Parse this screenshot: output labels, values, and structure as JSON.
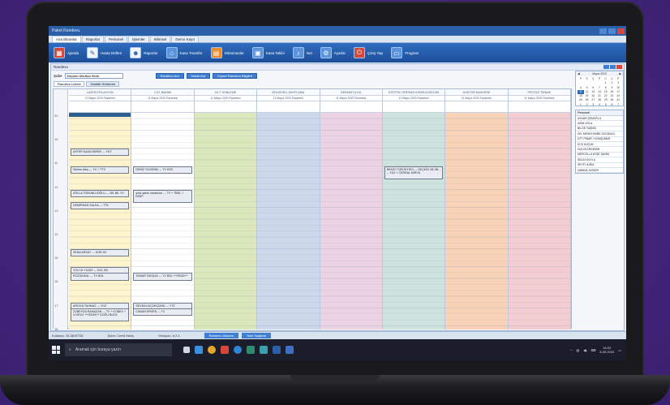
{
  "app": {
    "title": "Paket Randevu"
  },
  "menu_tabs": [
    "Ana Ekranlar",
    "Raporlar",
    "Personel",
    "İşlemler",
    "Bilimsel",
    "Demo Kayıt"
  ],
  "ribbon": [
    {
      "label": "Ajanda",
      "icon": "calendar-icon",
      "style": "red"
    },
    {
      "label": "Hasta Defteri",
      "icon": "pencil-icon",
      "style": "white"
    },
    {
      "label": "Raporlar",
      "icon": "user-icon",
      "style": "white"
    },
    {
      "label": "Kasa Transfer",
      "icon": "bank-icon",
      "style": "blue"
    },
    {
      "label": "Dökümanlar",
      "icon": "document-icon",
      "style": "orange"
    },
    {
      "label": "Kasa Takibi",
      "icon": "cash-icon",
      "style": "blue"
    },
    {
      "label": "Not",
      "icon": "note-icon",
      "style": "blue"
    },
    {
      "label": "Ayarlar",
      "icon": "settings-icon",
      "style": "blue"
    },
    {
      "label": "Çıkış Yap",
      "icon": "exit-icon",
      "style": "red"
    },
    {
      "label": "Program",
      "icon": "window-icon",
      "style": "blue"
    }
  ],
  "pane": {
    "title": "Randevu"
  },
  "filter": {
    "label": "Şube",
    "branch": "Meydan Medikal Klinik",
    "buttons": [
      "Randevu Ara",
      "Hasta Ara",
      "Kişisel Randevu Bilgileri"
    ]
  },
  "subtabs": [
    "Randevu Listesi",
    "Günlük Görünüm"
  ],
  "hours": [
    "09",
    "10",
    "11",
    "12",
    "13",
    "14",
    "15",
    "16",
    "17",
    "18"
  ],
  "columns": [
    {
      "name": "LAZER EPİLASYON",
      "date": "11 Mayıs 2020 Pazartesi",
      "color": "#fdf3cd"
    },
    {
      "name": "CİLT BAKIMI",
      "date": "11 Mayıs 2020 Pazartesi",
      "color": "#ffffff"
    },
    {
      "name": "CİLT YENİLEME",
      "date": "11 Mayıs 2020 Pazartesi",
      "color": "#dce8bc"
    },
    {
      "name": "BÖLGESEL ZAYIFLAMA",
      "date": "11 Mayıs 2020 Pazartesi",
      "color": "#cdd8ea"
    },
    {
      "name": "DERMATOLOJİ",
      "date": "11 Mayıs 2020 Pazartesi",
      "color": "#ecd3e3"
    },
    {
      "name": "ESTETİK CERRAHİ KONSÜLTASYON",
      "date": "11 Mayıs 2020 Pazartesi",
      "color": "#cfe3de"
    },
    {
      "name": "DOKTOR MUAYENE",
      "date": "11 Mayıs 2020 Pazartesi",
      "color": "#f8d3b8"
    },
    {
      "name": "PROTEZ TIRNAK",
      "date": "11 Mayıs 2020 Pazartesi",
      "color": "#f3cdd1"
    }
  ],
  "appointments": [
    {
      "col": 0,
      "slot": 6,
      "text": "AYFER KAAN MERİH --- YILT"
    },
    {
      "col": 0,
      "slot": 9,
      "text": "Selime Ateş --- YV + TTZ"
    },
    {
      "col": 0,
      "slot": 13,
      "text": "ATİLLA TORUNLUOĞLU --- BİL BİL YV"
    },
    {
      "col": 0,
      "slot": 15,
      "text": "DEMİRHAN SALKA --- TTK"
    },
    {
      "col": 0,
      "slot": 23,
      "text": "SENA ARSAY --- KOR 45"
    },
    {
      "col": 0,
      "slot": 26,
      "text": "YOLCU YILDIZ --- KUL KB"
    },
    {
      "col": 0,
      "slot": 27,
      "text": "ROZSA BAL --- TV BÖL"
    },
    {
      "col": 0,
      "slot": 32,
      "text": "ARDIYA TAHMAZ --- YOZ"
    },
    {
      "col": 0,
      "slot": 33,
      "text": "ZÜBEYDA RAMAZAN --- TV + KOBEX + 3 HIFU2 **YEDEK** DOĞU BÜCE"
    },
    {
      "col": 1,
      "slot": 9,
      "text": "DENİZ YILDIRIM --- TV KSE"
    },
    {
      "col": 1,
      "slot": 13,
      "text": "yeliz şahin karabulut --- TV + TBDL + BİSİP"
    },
    {
      "col": 1,
      "slot": 27,
      "text": "TAMAR TAVŞUN --- TV BÖL **YEDEK**"
    },
    {
      "col": 1,
      "slot": 32,
      "text": "SEVDA KÜÇÜKÇÜNÜ --- YTZ"
    },
    {
      "col": 1,
      "slot": 33,
      "text": "CANAN ERVEN --- TV"
    },
    {
      "col": 5,
      "slot": 9,
      "text": "BEKİR TOROSYEDİ --- SEÇKİN VB DB --- YÜZ + CERRAL MİRYA"
    }
  ],
  "mini_calendar": {
    "month": "Mayıs 2020",
    "days_header": [
      "P",
      "S",
      "Ç",
      "P",
      "C",
      "C",
      "P"
    ],
    "days": [
      "",
      "",
      "",
      "",
      "1",
      "2",
      "3",
      "4",
      "5",
      "6",
      "7",
      "8",
      "9",
      "10",
      "11",
      "12",
      "13",
      "14",
      "15",
      "16",
      "17",
      "18",
      "19",
      "20",
      "21",
      "22",
      "23",
      "24",
      "25",
      "26",
      "27",
      "28",
      "29",
      "30",
      "31",
      "1",
      "2",
      "3",
      "4",
      "5",
      "6",
      "7"
    ],
    "today": "11"
  },
  "personnel": {
    "title": "Personel",
    "items": [
      "AYNUR ŞENOĞLU",
      "ASİM VOLA",
      "BİLGE TAŞKIN",
      "DR. MEHRİ EMRE ÖZGÜNLÜ",
      "DTT PINAR / KONŞUMUR",
      "ECE KÜÇÜK",
      "HÜLYA ERDEMİR",
      "MERCELLA AYŞE ŞAHİN",
      "SELİN SOYLU",
      "SEYFİ JURİA",
      "ÜMMÜK GÖKER"
    ]
  },
  "status": {
    "user": "Kullanıcı: ELİŞKETİM",
    "branch": "Şube: Cemil Meriç",
    "version": "Versiyon: 6.2.4",
    "buttons": [
      "Randevu Aktarım",
      "Sıkıt Sağlantı"
    ]
  },
  "taskbar": {
    "search_placeholder": "Aramak için buraya yazın",
    "time": "16:02",
    "date": "8.05.2020"
  }
}
